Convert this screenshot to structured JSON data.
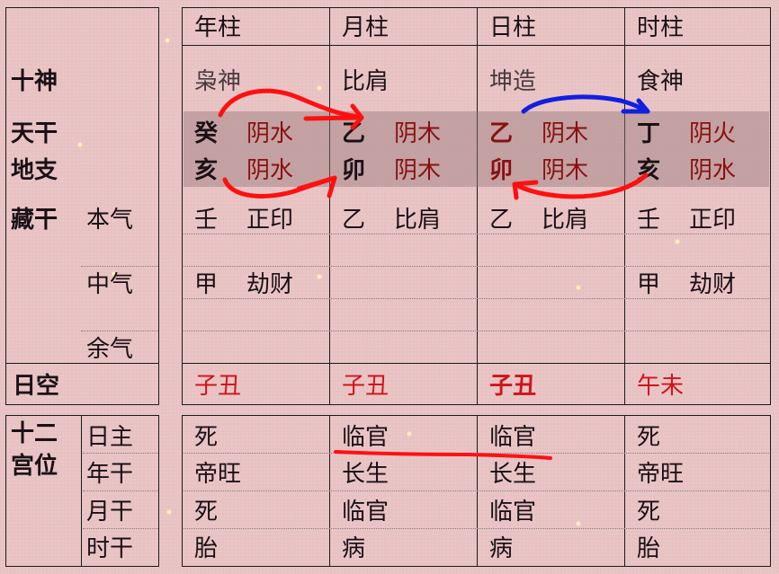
{
  "left_labels": {
    "shishen": "十神",
    "tiangan": "天干",
    "dizhi": "地支",
    "canggan": "藏干",
    "benqi": "本气",
    "zhongqi": "中气",
    "yuqi": "余气",
    "rikong": "日空",
    "shier": "十二",
    "gongwei": "宫位",
    "rizhu": "日主",
    "niangan": "年干",
    "yuegan": "月干",
    "shigan": "时干"
  },
  "pillars": [
    {
      "header": "年柱",
      "shishen": "枭神",
      "stem": "癸",
      "stem_element": "阴水",
      "branch": "亥",
      "branch_element": "阴水",
      "hidden": [
        {
          "stem": "壬",
          "god": "正印"
        },
        {
          "stem": "甲",
          "god": "劫财"
        },
        {
          "stem": "",
          "god": ""
        }
      ],
      "rikong": "子丑",
      "stages": [
        "死",
        "帝旺",
        "死",
        "胎"
      ]
    },
    {
      "header": "月柱",
      "shishen": "比肩",
      "stem": "乙",
      "stem_element": "阴木",
      "branch": "卯",
      "branch_element": "阴木",
      "hidden": [
        {
          "stem": "乙",
          "god": "比肩"
        },
        {
          "stem": "",
          "god": ""
        },
        {
          "stem": "",
          "god": ""
        }
      ],
      "rikong": "子丑",
      "stages": [
        "临官",
        "长生",
        "临官",
        "病"
      ]
    },
    {
      "header": "日柱",
      "shishen": "坤造",
      "stem": "乙",
      "stem_element": "阴木",
      "branch": "卯",
      "branch_element": "阴木",
      "hidden": [
        {
          "stem": "乙",
          "god": "比肩"
        },
        {
          "stem": "",
          "god": ""
        },
        {
          "stem": "",
          "god": ""
        }
      ],
      "rikong": "子丑",
      "stages": [
        "临官",
        "长生",
        "临官",
        "病"
      ]
    },
    {
      "header": "时柱",
      "shishen": "食神",
      "stem": "丁",
      "stem_element": "阴火",
      "branch": "亥",
      "branch_element": "阴水",
      "hidden": [
        {
          "stem": "壬",
          "god": "正印"
        },
        {
          "stem": "甲",
          "god": "劫财"
        },
        {
          "stem": "",
          "god": ""
        }
      ],
      "rikong": "午未",
      "stages": [
        "死",
        "帝旺",
        "死",
        "胎"
      ]
    }
  ],
  "colors": {
    "background": "#e8c2c3",
    "highlight_red": "#d0141a",
    "element_red": "#8a1010",
    "annotation_red": "#ff1010",
    "annotation_blue": "#1020e0"
  }
}
